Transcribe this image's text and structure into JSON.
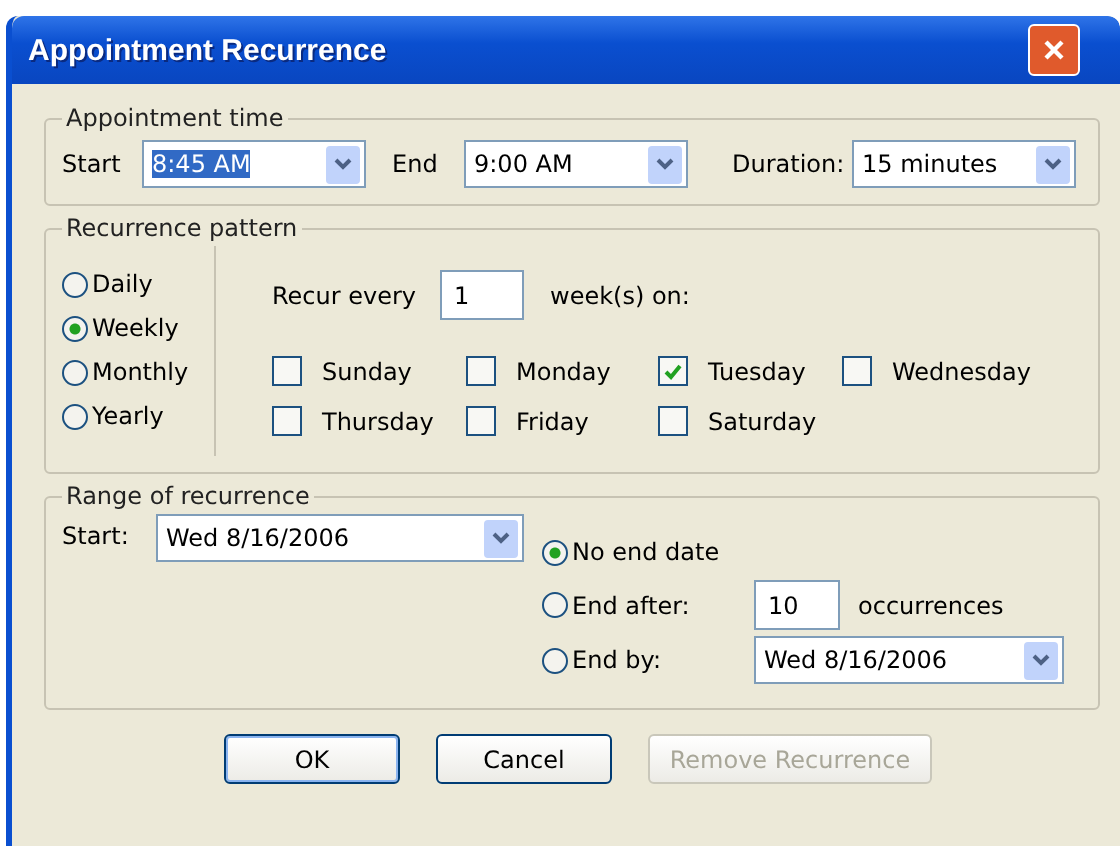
{
  "window": {
    "title": "Appointment Recurrence"
  },
  "appointment_time": {
    "legend": "Appointment time",
    "fields": [
      {
        "label": "Start",
        "value": "8:45 AM",
        "selected": true
      },
      {
        "label": "End",
        "value": "9:00 AM",
        "selected": false
      },
      {
        "label": "Duration:",
        "value": "15 minutes",
        "selected": false
      }
    ]
  },
  "recurrence_pattern": {
    "legend": "Recurrence pattern",
    "options": [
      {
        "label": "Daily",
        "selected": false
      },
      {
        "label": "Weekly",
        "selected": true
      },
      {
        "label": "Monthly",
        "selected": false
      },
      {
        "label": "Yearly",
        "selected": false
      }
    ],
    "recur_label": "Recur every",
    "recur_value": "1",
    "recur_suffix": "week(s) on:",
    "days": [
      {
        "label": "Sunday",
        "checked": false
      },
      {
        "label": "Monday",
        "checked": false
      },
      {
        "label": "Tuesday",
        "checked": true
      },
      {
        "label": "Wednesday",
        "checked": false
      },
      {
        "label": "Thursday",
        "checked": false
      },
      {
        "label": "Friday",
        "checked": false
      },
      {
        "label": "Saturday",
        "checked": false
      }
    ]
  },
  "range": {
    "legend": "Range of recurrence",
    "start_label": "Start:",
    "start_value": "Wed 8/16/2006",
    "no_end": {
      "label": "No end date",
      "selected": true
    },
    "end_after": {
      "label": "End after:",
      "selected": false,
      "value": "10",
      "suffix": "occurrences"
    },
    "end_by": {
      "label": "End by:",
      "selected": false,
      "value": "Wed 8/16/2006"
    }
  },
  "buttons": [
    {
      "label": "OK",
      "disabled": false,
      "default": true
    },
    {
      "label": "Cancel",
      "disabled": false,
      "default": false
    },
    {
      "label": "Remove Recurrence",
      "disabled": true,
      "default": false
    }
  ]
}
